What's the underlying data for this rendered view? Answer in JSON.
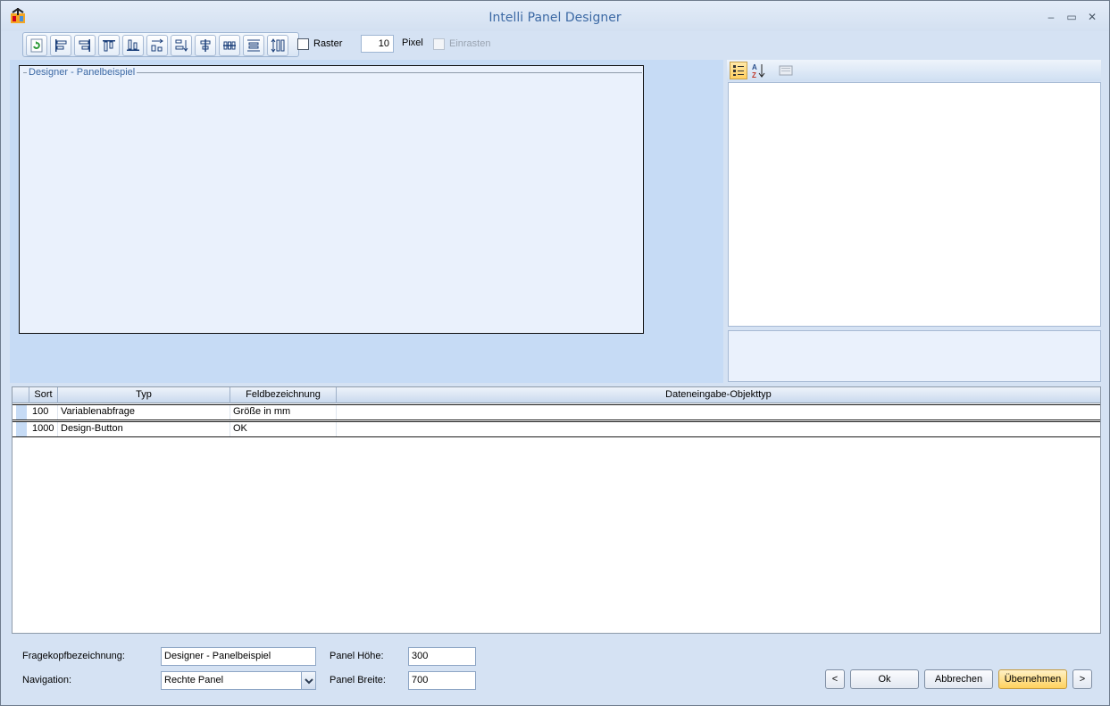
{
  "window": {
    "title": "Intelli Panel Designer",
    "minimize": "–",
    "maximize": "▭",
    "close": "✕"
  },
  "toolbar": {
    "raster_label": "Raster",
    "raster_checked": false,
    "grid_size": "10",
    "pixel_label": "Pixel",
    "snap_label": "Einrasten",
    "snap_enabled": false
  },
  "designer": {
    "panel_title": "Designer - Panelbeispiel"
  },
  "grid": {
    "columns": [
      "Sort",
      "Typ",
      "Feldbezeichnung",
      "Dateneingabe-Objekttyp"
    ],
    "rows": [
      {
        "sort": "100",
        "typ": "Variablenabfrage",
        "feld": "Größe in mm",
        "objekttyp": ""
      },
      {
        "sort": "1000",
        "typ": "Design-Button",
        "feld": "OK",
        "objekttyp": ""
      }
    ]
  },
  "form": {
    "fragekopf_label": "Fragekopfbezeichnung:",
    "fragekopf_value": "Designer - Panelbeispiel",
    "navigation_label": "Navigation:",
    "navigation_value": "Rechte Panel",
    "hoehe_label": "Panel Höhe:",
    "hoehe_value": "300",
    "breite_label": "Panel Breite:",
    "breite_value": "700"
  },
  "buttons": {
    "prev": "<",
    "ok": "Ok",
    "cancel": "Abbrechen",
    "apply": "Übernehmen",
    "next": ">"
  },
  "colors": {
    "title": "#3d6aa5",
    "designer_bg": "#c6dbf5",
    "apply_button": "#ffd25e"
  }
}
